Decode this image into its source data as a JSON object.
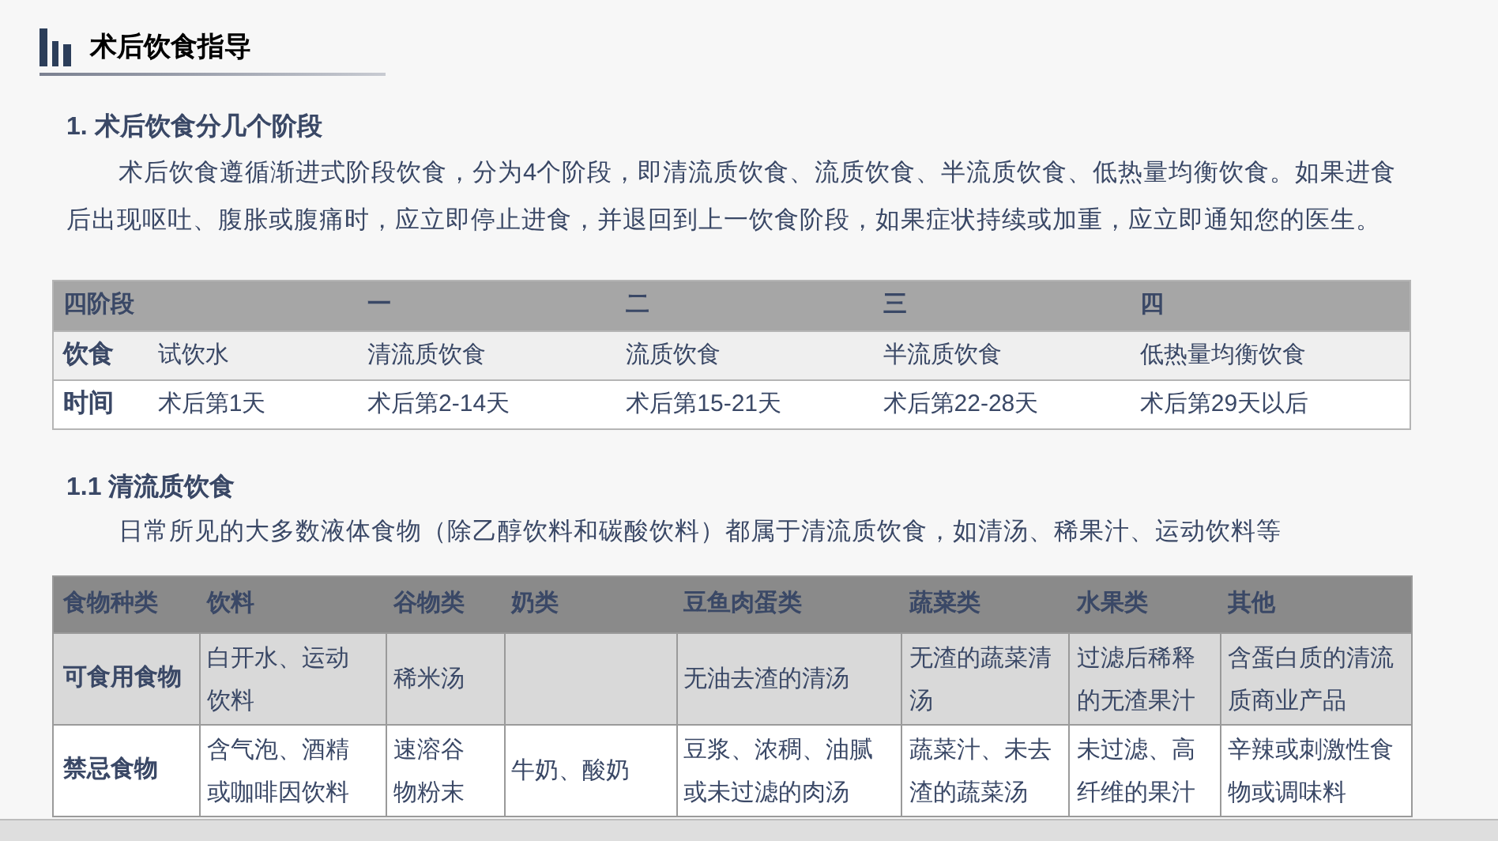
{
  "title": "术后饮食指导",
  "section_1": {
    "heading": "1. 术后饮食分几个阶段",
    "paragraph": "术后饮食遵循渐进式阶段饮食，分为4个阶段，即清流质饮食、流质饮食、半流质饮食、低热量均衡饮食。如果进食后出现呕吐、腹胀或腹痛时，应立即停止进食，并退回到上一饮食阶段，如果症状持续或加重，应立即通知您的医生。"
  },
  "stages_table": {
    "columns": [
      "四阶段",
      "",
      "一",
      "二",
      "三",
      "四"
    ],
    "rows": [
      [
        "饮食",
        "试饮水",
        "清流质饮食",
        "流质饮食",
        "半流质饮食",
        "低热量均衡饮食"
      ],
      [
        "时间",
        "术后第1天",
        "术后第2-14天",
        "术后第15-21天",
        "术后第22-28天",
        "术后第29天以后"
      ]
    ]
  },
  "section_1_1": {
    "heading": "1.1 清流质饮食",
    "paragraph": "日常所见的大多数液体食物（除乙醇饮料和碳酸饮料）都属于清流质饮食，如清汤、稀果汁、运动饮料等"
  },
  "food_table": {
    "columns": [
      "食物种类",
      "饮料",
      "谷物类",
      "奶类",
      "豆鱼肉蛋类",
      "蔬菜类",
      "水果类",
      "其他"
    ],
    "rows": [
      [
        "可食用食物",
        "白开水、运动饮料",
        "稀米汤",
        "",
        "无油去渣的清汤",
        "无渣的蔬菜清汤",
        "过滤后稀释的无渣果汁",
        "含蛋白质的清流质商业产品"
      ],
      [
        "禁忌食物",
        "含气泡、酒精或咖啡因饮料",
        "速溶谷物粉末",
        "牛奶、酸奶",
        "豆浆、浓稠、油腻或未过滤的肉汤",
        "蔬菜汁、未去渣的蔬菜汤",
        "未过滤、高纤维的果汁",
        "辛辣或刺激性食物或调味料"
      ]
    ]
  }
}
